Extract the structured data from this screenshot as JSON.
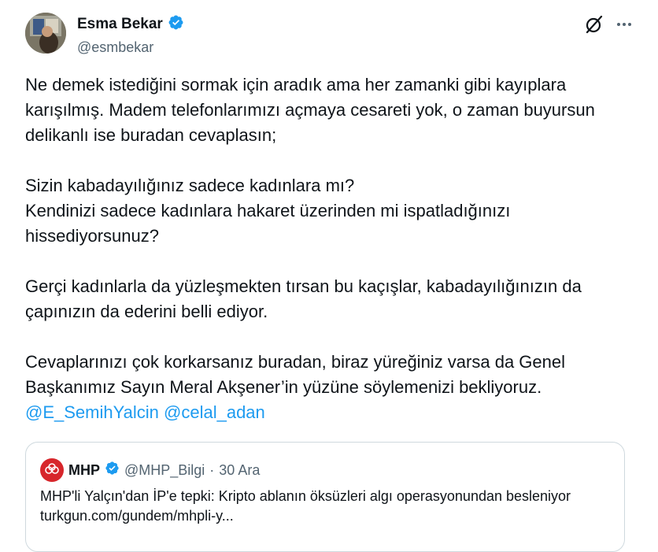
{
  "author": {
    "display_name": "Esma Bekar",
    "handle": "@esmbekar",
    "verified_color": "#1d9bf0"
  },
  "actions": {
    "grok_icon": "grok-icon",
    "more_icon": "more-icon"
  },
  "tweet": {
    "p1": "Ne demek istediğini sormak için aradık ama her zamanki gibi kayıplara karışılmış. Madem telefonlarımızı açmaya cesareti yok, o zaman buyursun delikanlı ise buradan cevaplasın;",
    "p2_line1": "Sizin kabadayılığınız sadece kadınlara mı?",
    "p2_line2": "Kendinizi sadece kadınlara hakaret üzerinden mi ispatladığınızı hissediyorsunuz?",
    "p3": "Gerçi kadınlarla da yüzleşmekten tırsan bu kaçışlar, kabadayılığınızın da çapınızın da ederini belli ediyor.",
    "p4": "Cevaplarınızı çok korkarsanız buradan, biraz yüreğiniz varsa da Genel Başkanımız Sayın Meral Akşener’in yüzüne söylemenizi bekliyoruz.",
    "mention1": "@E_SemihYalcin",
    "mention2": "@celal_adan"
  },
  "quote": {
    "name": "MHP",
    "handle": "@MHP_Bilgi",
    "separator": "·",
    "date": "30 Ara",
    "text": "MHP'li Yalçın'dan İP'e tepki: Kripto ablanın öksüzleri algı operasyonundan besleniyor turkgun.com/gundem/mhpli-y..."
  }
}
